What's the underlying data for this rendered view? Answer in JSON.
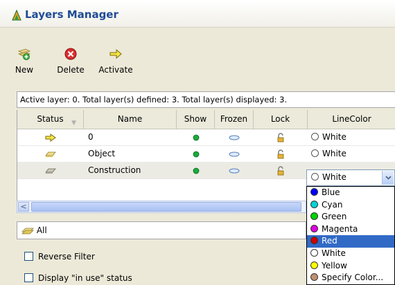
{
  "window": {
    "title": "Layers Manager"
  },
  "toolbar": {
    "new_label": "New",
    "delete_label": "Delete",
    "activate_label": "Activate"
  },
  "status_line": "Active layer: 0. Total layer(s) defined: 3. Total layer(s) displayed: 3.",
  "columns": {
    "status": "Status",
    "name": "Name",
    "show": "Show",
    "frozen": "Frozen",
    "lock": "Lock",
    "linecolor": "LineColor"
  },
  "rows": [
    {
      "status_icon": "active-arrow-icon",
      "name": "0",
      "show": "on",
      "frozen": "no",
      "lock": "unlocked",
      "linecolor": "White"
    },
    {
      "status_icon": "folder-icon",
      "name": "Object",
      "show": "on",
      "frozen": "no",
      "lock": "unlocked",
      "linecolor": "White"
    },
    {
      "status_icon": "folder-icon",
      "name": "Construction",
      "show": "on",
      "frozen": "no",
      "lock": "unlocked",
      "linecolor": "White"
    }
  ],
  "color_dropdown": {
    "selected": "White",
    "highlighted": "Red",
    "options": [
      {
        "label": "Blue",
        "color": "#0000ff"
      },
      {
        "label": "Cyan",
        "color": "#00d6d6"
      },
      {
        "label": "Green",
        "color": "#00d200"
      },
      {
        "label": "Magenta",
        "color": "#e000e0"
      },
      {
        "label": "Red",
        "color": "#d00000"
      },
      {
        "label": "White",
        "color": "#ffffff"
      },
      {
        "label": "Yellow",
        "color": "#ffff00"
      },
      {
        "label": "Specify Color...",
        "color": "#c09070"
      }
    ]
  },
  "filter": {
    "label": "All"
  },
  "options": {
    "reverse_filter_label": "Reverse Filter",
    "in_use_label": "Display \"in use\" status"
  },
  "colors": {
    "title_text": "#1f4b95",
    "highlight": "#316ac5",
    "show_dot": "#1aaa3c"
  }
}
